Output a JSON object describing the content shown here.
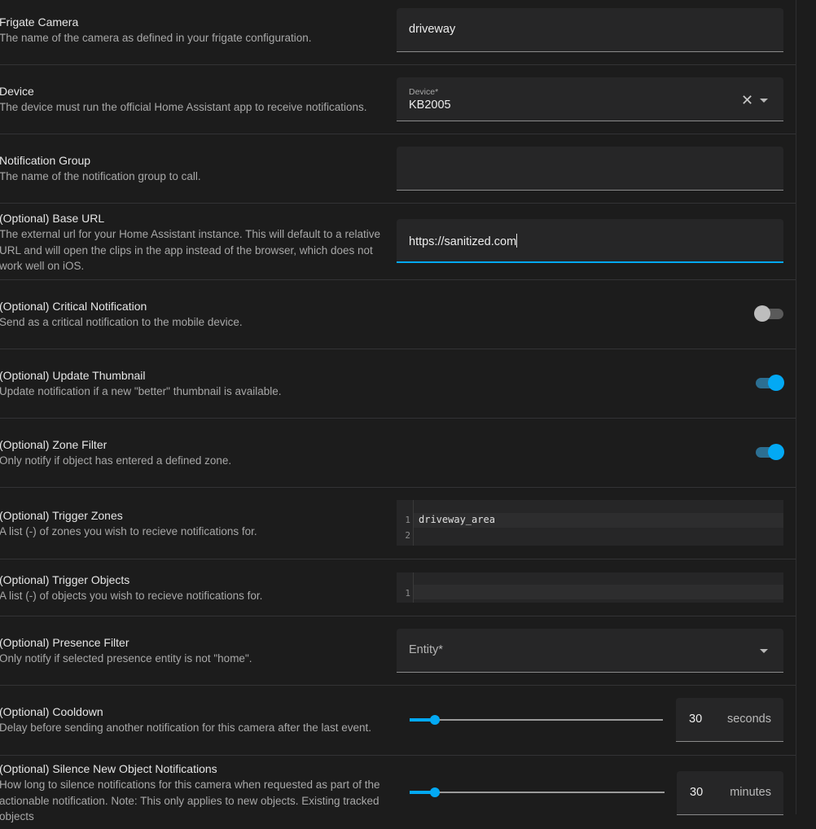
{
  "rows": {
    "frigate_camera": {
      "title": "Frigate Camera",
      "desc": "The name of the camera as defined in your frigate configuration.",
      "value": "driveway"
    },
    "device": {
      "title": "Device",
      "desc": "The device must run the official Home Assistant app to receive notifications.",
      "label": "Device*",
      "value": "KB2005",
      "clear_icon": "close-icon",
      "dropdown_icon": "chevron-down-icon"
    },
    "notification_group": {
      "title": "Notification Group",
      "desc": "The name of the notification group to call.",
      "value": ""
    },
    "base_url": {
      "title": "(Optional) Base URL",
      "desc_lines": [
        "The external url for your Home Assistant instance. This will default to a relative",
        "URL and will open the clips in the app instead of the browser, which does not",
        "work well on iOS."
      ],
      "value": "https://sanitized.com"
    },
    "critical": {
      "title": "(Optional) Critical Notification",
      "desc": "Send as a critical notification to the mobile device.",
      "enabled": false
    },
    "update_thumbnail": {
      "title": "(Optional) Update Thumbnail",
      "desc": "Update notification if a new \"better\" thumbnail is available.",
      "enabled": true
    },
    "zone_filter": {
      "title": "(Optional) Zone Filter",
      "desc": "Only notify if object has entered a defined zone.",
      "enabled": true
    },
    "trigger_zones": {
      "title": "(Optional) Trigger Zones",
      "desc": "A list (-) of zones you wish to recieve notifications for.",
      "lines": [
        "driveway_area",
        ""
      ],
      "line_numbers": [
        "1",
        "2"
      ]
    },
    "trigger_objects": {
      "title": "(Optional) Trigger Objects",
      "desc": "A list (-) of objects you wish to recieve notifications for.",
      "lines": [
        ""
      ],
      "line_numbers": [
        "1"
      ]
    },
    "presence_filter": {
      "title": "(Optional) Presence Filter",
      "desc": "Only notify if selected presence entity is not \"home\".",
      "placeholder": "Entity*",
      "dropdown_icon": "chevron-down-icon"
    },
    "cooldown": {
      "title": "(Optional) Cooldown",
      "desc": "Delay before sending another notification for this camera after the last event.",
      "value": "30",
      "unit": "seconds",
      "slider_fraction": 0.1
    },
    "silence": {
      "title": "(Optional) Silence New Object Notifications",
      "desc_lines": [
        "How long to silence notifications for this camera when requested as part of the",
        "actionable notification. Note: This only applies to new objects. Existing tracked",
        "objects"
      ],
      "value": "30",
      "unit": "minutes",
      "slider_fraction": 0.1
    }
  },
  "colors": {
    "background": "#1c1c1c",
    "accent": "#03a9f4",
    "field": "#262627"
  }
}
